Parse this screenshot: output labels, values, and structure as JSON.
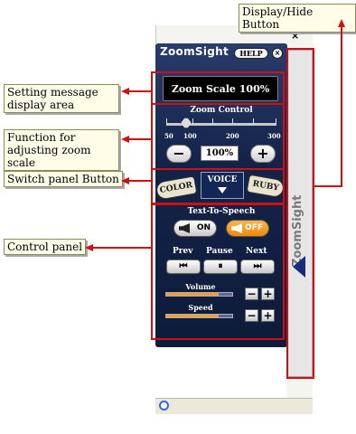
{
  "host_window": {
    "close_glyph": "×"
  },
  "zoomsight": {
    "logo": "ZoomSight",
    "help_label": "HELP",
    "close_glyph": "×",
    "message": "Zoom Scale  100%",
    "zoom_control": {
      "title": "Zoom Control",
      "tick_labels": [
        "50",
        "100",
        "200",
        "300"
      ],
      "minus": "−",
      "plus": "+",
      "value": "100%",
      "level": 100
    },
    "tabs": {
      "color": "COLOR",
      "voice": "VOICE",
      "ruby": "RUBY"
    },
    "tts": {
      "title": "Text-To-Speech",
      "on": "ON",
      "off": "OFF"
    },
    "playback": {
      "prev": "Prev",
      "pause": "Pause",
      "next": "Next",
      "prev_icon": "⏮",
      "pause_icon": "⏸",
      "next_icon": "⏭"
    },
    "volume": {
      "label": "Volume",
      "level": 0.8
    },
    "speed": {
      "label": "Speed",
      "level": 0.8
    },
    "strip_logo": "ZoomSight"
  },
  "callouts": {
    "display_hide": "Display/Hide Button",
    "setting_message": "Setting message display area",
    "zoom_function": "Function for adjusting zoom scale",
    "switch_panel": "Switch panel Button",
    "control_panel": "Control panel"
  },
  "colors": {
    "annotation_red": "#d01010",
    "panel_navy": "#132348",
    "tts_off_orange": "#f08a0a"
  }
}
